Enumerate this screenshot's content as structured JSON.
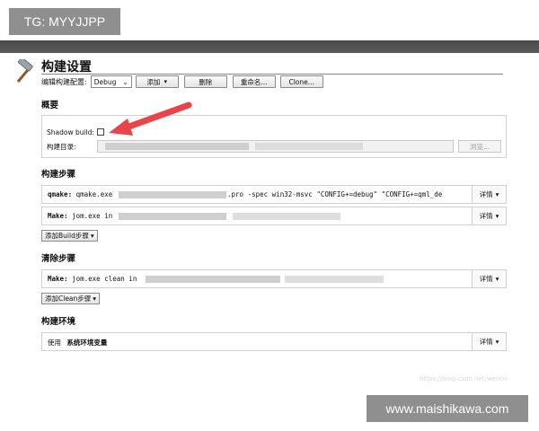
{
  "badge": {
    "text": "TG: MYYJJPP"
  },
  "header": {
    "title": "构建设置"
  },
  "toolbar": {
    "edit_config_label": "编辑构建配置:",
    "config_value": "Debug",
    "add_label": "添加",
    "delete_label": "删除",
    "rename_label": "重命名...",
    "clone_label": "Clone..."
  },
  "overview": {
    "title": "概要",
    "shadow_build_label": "Shadow build:",
    "shadow_build_checked": false,
    "build_dir_label": "构建目录:",
    "build_dir_value": "",
    "browse_label": "浏览..."
  },
  "build_steps": {
    "title": "构建步骤",
    "steps": [
      {
        "prefix": "qmake:",
        "text": "qmake.exe",
        "suffix": ".pro -spec win32-msvc \"CONFIG+=debug\" \"CONFIG+=qml_de"
      },
      {
        "prefix": "Make:",
        "text": "jom.exe in"
      }
    ],
    "details_label": "详情",
    "add_label": "添加Build步骤"
  },
  "clean_steps": {
    "title": "清除步骤",
    "steps": [
      {
        "prefix": "Make:",
        "text": "jom.exe clean in"
      }
    ],
    "details_label": "详情",
    "add_label": "添加Clean步骤"
  },
  "build_env": {
    "title": "构建环境",
    "use_label": "使用",
    "env_value": "系统环境变量",
    "details_label": "详情"
  },
  "watermarks": {
    "blog": "https://blog.csdn.net/weixin",
    "site": "www.maishikawa.com"
  },
  "colors": {
    "arrow": "#e8444a",
    "panel_bar": "#4a4a4a"
  },
  "icons": {
    "title_icon": "hammer-icon"
  }
}
